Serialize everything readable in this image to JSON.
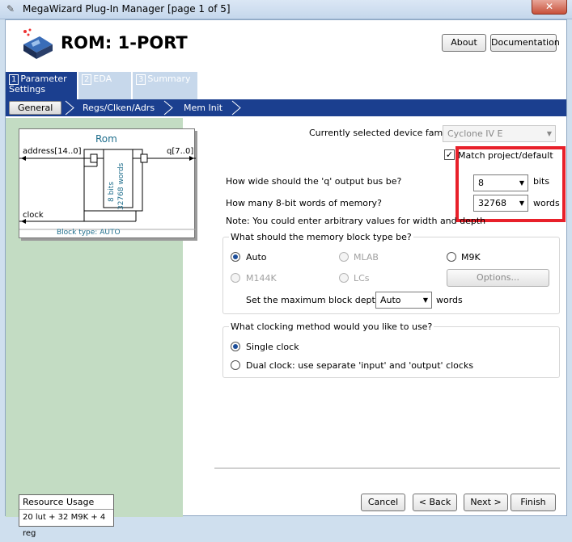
{
  "window": {
    "title": "MegaWizard Plug-In Manager [page 1 of 5]",
    "close_label": "✕"
  },
  "header": {
    "title": "ROM: 1-PORT",
    "about_label": "About",
    "documentation_label": "Documentation"
  },
  "tabs": [
    {
      "num": "1",
      "label": "Parameter Settings"
    },
    {
      "num": "2",
      "label": "EDA"
    },
    {
      "num": "3",
      "label": "Summary"
    }
  ],
  "subtabs": [
    "General",
    "Regs/Clken/Adrs",
    "Mem Init"
  ],
  "symbol": {
    "title": "Rom",
    "address": "address[14..0]",
    "q": "q[7..0]",
    "clock": "clock",
    "block_type": "Block type: AUTO",
    "bits": "8 bits",
    "words": "32768 words"
  },
  "resource": {
    "heading": "Resource Usage",
    "value": "20 lut + 32 M9K + 4 reg"
  },
  "device": {
    "label": "Currently selected device family:",
    "value": "Cyclone IV E",
    "match_label": "Match project/default",
    "match_checked": true
  },
  "width_q": {
    "label": "How wide should the 'q' output bus be?",
    "value": "8",
    "unit": "bits"
  },
  "depth": {
    "label": "How many 8-bit words of memory?",
    "value": "32768",
    "unit": "words"
  },
  "note": "Note: You could enter arbitrary values for width and depth",
  "memblock": {
    "title": "What should the memory block type be?",
    "auto": "Auto",
    "mlab": "MLAB",
    "m9k": "M9K",
    "m144k": "M144K",
    "lcs": "LCs",
    "options_label": "Options...",
    "maxdepth_label": "Set the maximum block depth to",
    "maxdepth_value": "Auto",
    "maxdepth_unit": "words"
  },
  "clocking": {
    "title": "What clocking method would you like to use?",
    "single": "Single clock",
    "dual": "Dual clock: use separate 'input' and 'output' clocks"
  },
  "footer": {
    "cancel": "Cancel",
    "back": "< Back",
    "next": "Next >",
    "finish": "Finish"
  }
}
